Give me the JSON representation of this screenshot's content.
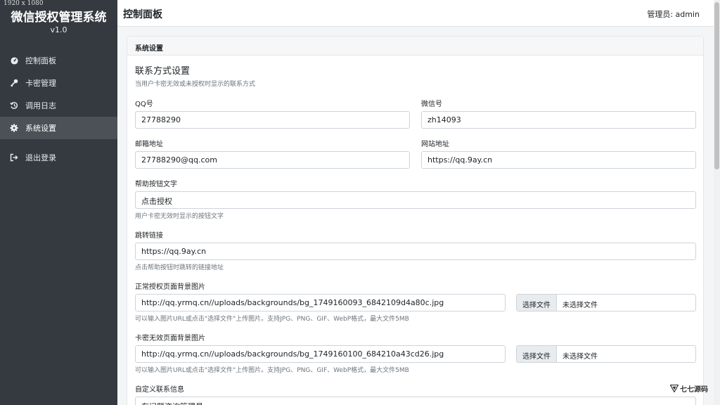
{
  "resolution_tag": "1920 x 1080",
  "sidebar": {
    "brand": "微信授权管理系统",
    "version": "v1.0",
    "items": [
      {
        "label": "控制面板",
        "icon": "dashboard-icon"
      },
      {
        "label": "卡密管理",
        "icon": "key-icon"
      },
      {
        "label": "调用日志",
        "icon": "history-icon"
      },
      {
        "label": "系统设置",
        "icon": "gear-icon",
        "active": true
      }
    ],
    "logout": {
      "label": "退出登录",
      "icon": "logout-icon"
    }
  },
  "header": {
    "title": "控制面板",
    "user": "管理员: admin"
  },
  "card": {
    "header": "系统设置",
    "section_title": "联系方式设置",
    "section_desc": "当用户卡密无效或未授权时显示的联系方式",
    "fields": {
      "qq": {
        "label": "QQ号",
        "value": "27788290"
      },
      "wechat": {
        "label": "微信号",
        "value": "zh14093"
      },
      "email": {
        "label": "邮箱地址",
        "value": "27788290@qq.com"
      },
      "website": {
        "label": "网站地址",
        "value": "https://qq.9ay.cn"
      },
      "help_text": {
        "label": "帮助按钮文字",
        "value": "点击授权",
        "hint": "用户卡密无效时显示的按钮文字"
      },
      "redirect": {
        "label": "跳转链接",
        "value": "https://qq.9ay.cn",
        "hint": "点击帮助按钮时跳转的链接地址"
      },
      "normal_bg": {
        "label": "正常授权页面背景图片",
        "value": "http://qq.yrmq.cn//uploads/backgrounds/bg_1749160093_6842109d4a80c.jpg",
        "hint": "可以输入图片URL或点击\"选择文件\"上传图片。支持JPG、PNG、GIF、WebP格式，最大文件5MB",
        "file_button": "选择文件",
        "file_name": "未选择文件"
      },
      "invalid_bg": {
        "label": "卡密无效页面背景图片",
        "value": "http://qq.yrmq.cn//uploads/backgrounds/bg_1749160100_684210a43cd26.jpg",
        "hint": "可以输入图片URL或点击\"选择文件\"上传图片。支持JPG、PNG、GIF、WebP格式，最大文件5MB",
        "file_button": "选择文件",
        "file_name": "未选择文件"
      },
      "custom": {
        "label": "自定义联系信息",
        "value": "有问题资询管理员"
      }
    }
  },
  "watermark": {
    "text": "七七源码",
    "icon": "triangle-logo-icon"
  }
}
